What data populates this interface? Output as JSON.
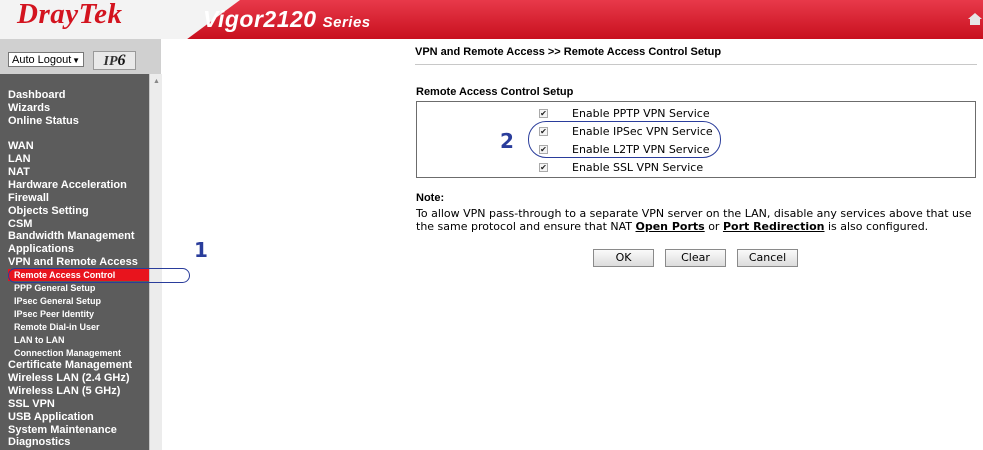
{
  "header": {
    "logo": "DrayTek",
    "model": "Vigor2120",
    "series": "Series"
  },
  "sidebar": {
    "auto_logout": "Auto Logout",
    "ipv6_label": "IP",
    "ipv6_suffix": "6",
    "menu": [
      {
        "label": "Dashboard"
      },
      {
        "label": "Wizards"
      },
      {
        "label": "Online Status"
      },
      {
        "label": "WAN"
      },
      {
        "label": "LAN"
      },
      {
        "label": "NAT"
      },
      {
        "label": "Hardware Acceleration"
      },
      {
        "label": "Firewall"
      },
      {
        "label": "Objects Setting"
      },
      {
        "label": "CSM"
      },
      {
        "label": "Bandwidth Management"
      },
      {
        "label": "Applications"
      },
      {
        "label": "VPN and Remote Access"
      },
      {
        "label": "Certificate Management"
      },
      {
        "label": "Wireless LAN (2.4 GHz)"
      },
      {
        "label": "Wireless LAN (5 GHz)"
      },
      {
        "label": "SSL VPN"
      },
      {
        "label": "USB Application"
      },
      {
        "label": "System Maintenance"
      },
      {
        "label": "Diagnostics"
      }
    ],
    "submenu": [
      {
        "label": "Remote Access Control",
        "active": true
      },
      {
        "label": "PPP General Setup"
      },
      {
        "label": "IPsec General Setup"
      },
      {
        "label": "IPsec Peer Identity"
      },
      {
        "label": "Remote Dial-in User"
      },
      {
        "label": "LAN to LAN"
      },
      {
        "label": "Connection Management"
      }
    ]
  },
  "annotations": {
    "one": "1",
    "two": "2"
  },
  "main": {
    "breadcrumb": "VPN and Remote Access >> Remote Access Control Setup",
    "section_title": "Remote Access Control Setup",
    "options": [
      {
        "label": "Enable PPTP VPN Service",
        "checked": true
      },
      {
        "label": "Enable IPSec VPN Service",
        "checked": true
      },
      {
        "label": "Enable L2TP VPN Service",
        "checked": true
      },
      {
        "label": "Enable SSL VPN Service",
        "checked": true
      }
    ],
    "note_title": "Note:",
    "note_part1": "To allow VPN pass-through to a separate VPN server on the LAN, disable any services above that use the same protocol and ensure that NAT ",
    "note_link1": "Open Ports",
    "note_part2": " or ",
    "note_link2": "Port Redirection",
    "note_part3": " is also configured.",
    "buttons": {
      "ok": "OK",
      "clear": "Clear",
      "cancel": "Cancel"
    }
  },
  "colors": {
    "brand_red": "#d3141f",
    "active_menu": "#e8141d",
    "sidebar_bg": "#5c5c5c",
    "annotation_blue": "#2a3d9b"
  }
}
